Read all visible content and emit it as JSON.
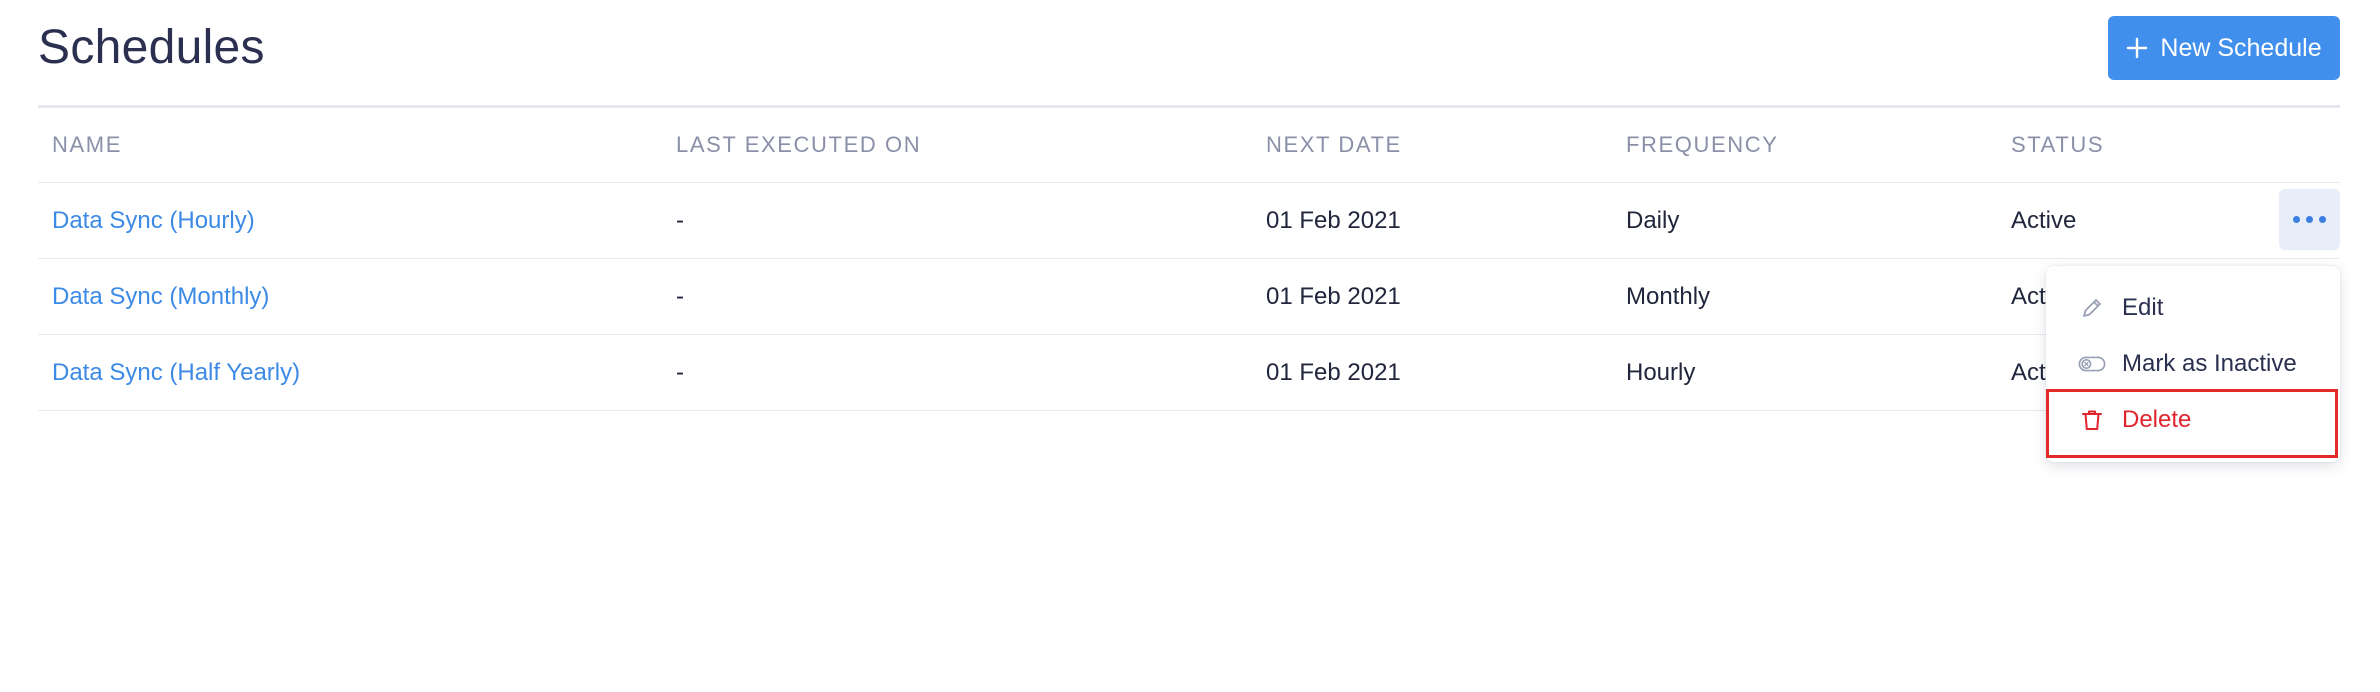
{
  "header": {
    "title": "Schedules",
    "new_button_label": "New Schedule"
  },
  "table": {
    "columns": [
      "NAME",
      "LAST EXECUTED ON",
      "NEXT DATE",
      "FREQUENCY",
      "STATUS"
    ],
    "rows": [
      {
        "name": "Data Sync (Hourly)",
        "last_executed_on": "-",
        "next_date": "01 Feb 2021",
        "frequency": "Daily",
        "status": "Active"
      },
      {
        "name": "Data Sync (Monthly)",
        "last_executed_on": "-",
        "next_date": "01 Feb 2021",
        "frequency": "Monthly",
        "status": "Act"
      },
      {
        "name": "Data Sync (Half Yearly)",
        "last_executed_on": "-",
        "next_date": "01 Feb 2021",
        "frequency": "Hourly",
        "status": "Act"
      }
    ]
  },
  "row_menu": {
    "items": [
      {
        "label": "Edit",
        "icon": "pencil-icon"
      },
      {
        "label": "Mark as Inactive",
        "icon": "toggle-off-icon"
      },
      {
        "label": "Delete",
        "icon": "trash-icon"
      }
    ]
  },
  "colors": {
    "accent": "#408fec",
    "link": "#3b8ae6",
    "danger": "#e0252f",
    "highlight": "#e32a26"
  }
}
